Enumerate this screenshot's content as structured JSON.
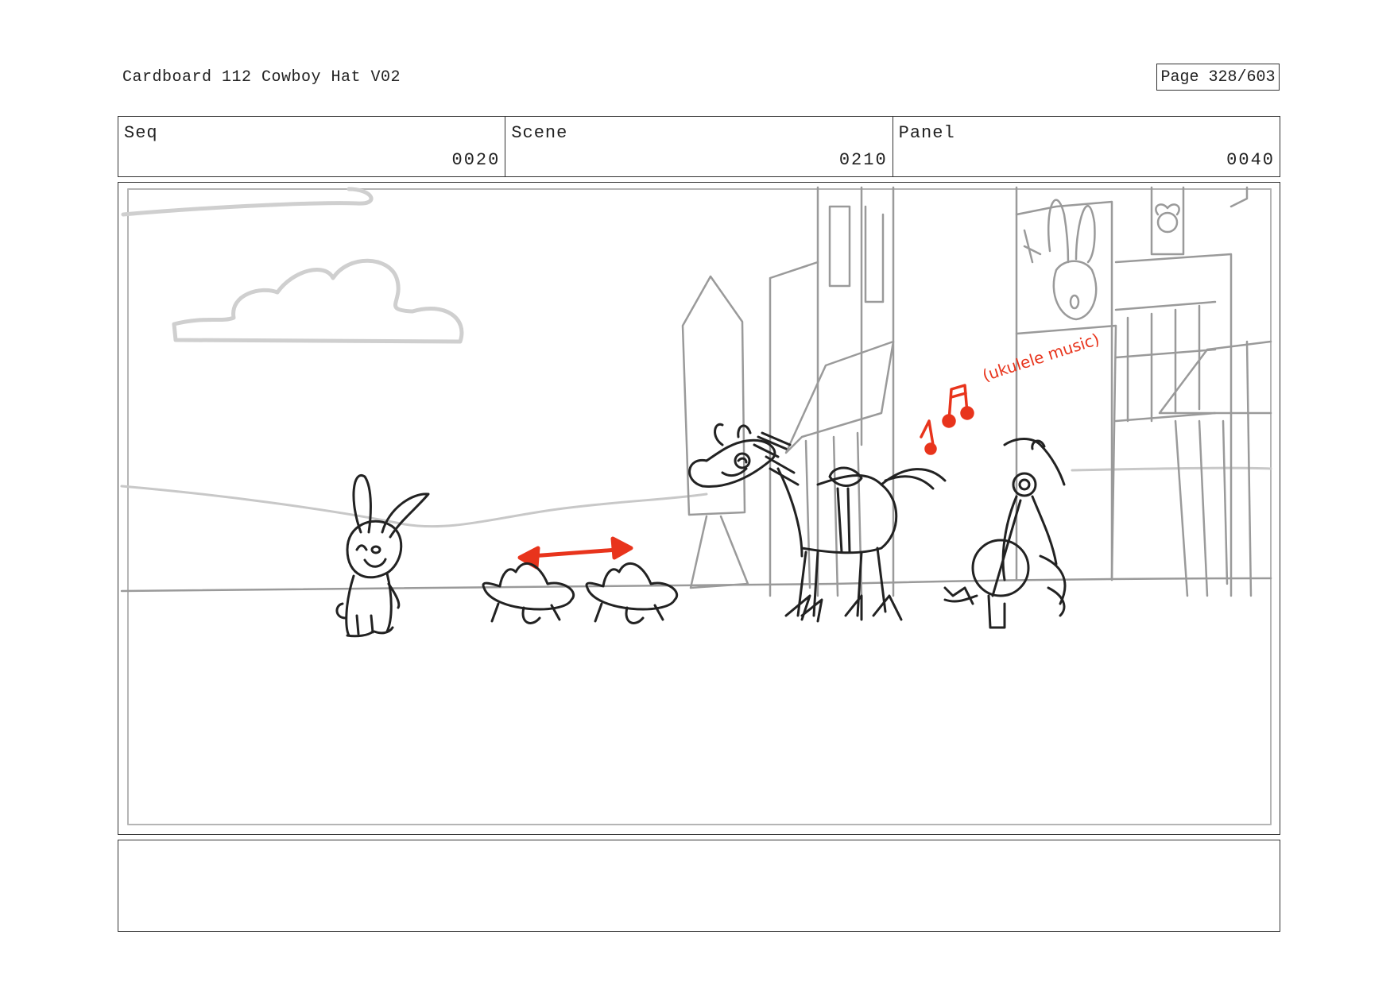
{
  "header": {
    "title": "Cardboard 112 Cowboy Hat V02",
    "page": "Page 328/603"
  },
  "info": {
    "seq_label": "Seq",
    "seq_value": "0020",
    "scene_label": "Scene",
    "scene_value": "0210",
    "panel_label": "Panel",
    "panel_value": "0040"
  },
  "sketch": {
    "annotation": "(ukulele music)",
    "line_color": "#222222",
    "bg_line_color": "#9a9a9a",
    "sky_line_color": "#cfcfcf",
    "accent_color": "#e8341c"
  },
  "notes": {
    "text": ""
  }
}
